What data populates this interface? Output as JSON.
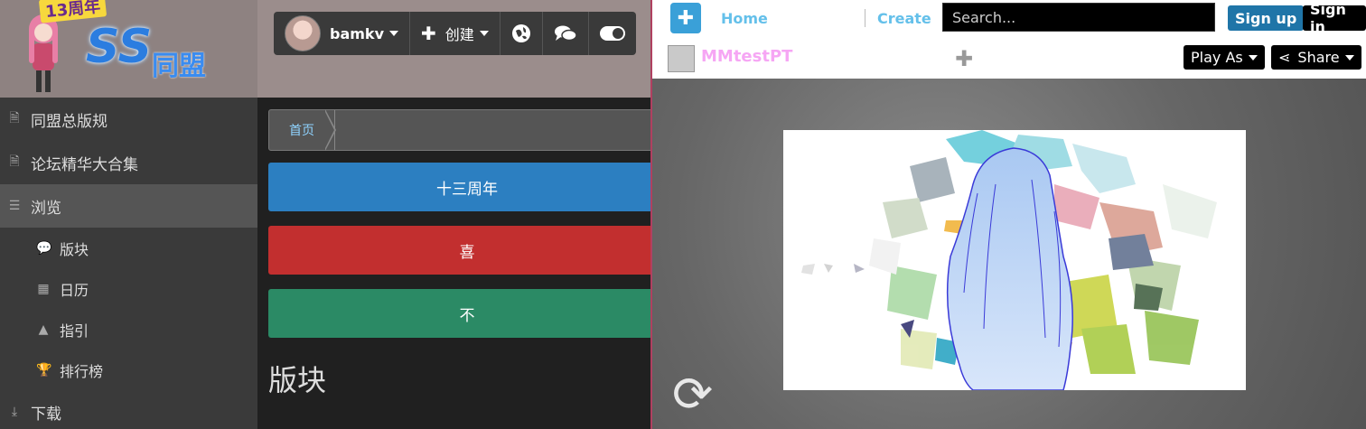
{
  "left": {
    "logo": {
      "badge": "13周年",
      "ss": "SS",
      "cn": "同盟"
    },
    "topnav": {
      "username": "bamkv",
      "create_label": "创建"
    },
    "sidebar": {
      "items": [
        {
          "label": "同盟总版规"
        },
        {
          "label": "论坛精华大合集"
        },
        {
          "label": "浏览"
        },
        {
          "label": "版块"
        },
        {
          "label": "日历"
        },
        {
          "label": "指引"
        },
        {
          "label": "排行榜"
        },
        {
          "label": "下载"
        }
      ]
    },
    "breadcrumb": {
      "home": "首页"
    },
    "banners": [
      {
        "text": "十三周年"
      },
      {
        "text": "喜"
      },
      {
        "text": "不"
      }
    ],
    "section_title": "版块"
  },
  "right": {
    "nav": {
      "home": "Home",
      "create": "Create",
      "search_placeholder": "Search...",
      "signup": "Sign up",
      "signin": "Sign in"
    },
    "puzzle": {
      "author": "MMtestPT",
      "play_as": "Play As",
      "share": "Share"
    }
  },
  "colors": {
    "accent_blue": "#2c7fc1",
    "accent_red": "#c22f2f",
    "accent_green": "#2b8a65",
    "link_blue": "#64c0ea",
    "author_pink": "#f6a6f4"
  }
}
